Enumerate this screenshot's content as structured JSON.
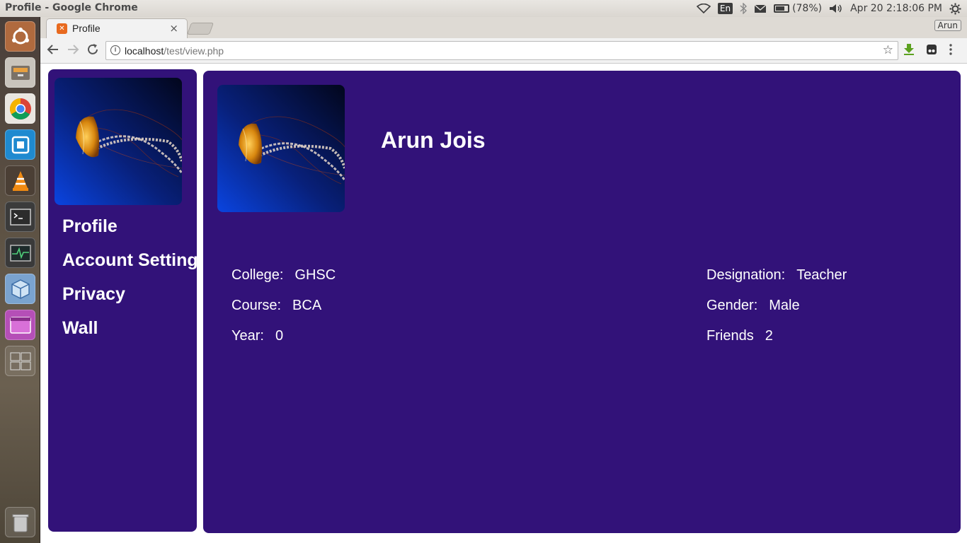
{
  "os": {
    "window_title": "Profile - Google Chrome",
    "tray": {
      "keyboard": "En",
      "battery": "(78%)",
      "battery_level": 0.78,
      "datetime": "Apr 20  2:18:06 PM"
    }
  },
  "browser": {
    "tab_title": "Profile",
    "tab_close": "×",
    "user": "Arun",
    "url_host": "localhost",
    "url_path": "/test/view.php"
  },
  "page": {
    "nav": [
      "Profile",
      "Account Setting",
      "Privacy",
      "Wall"
    ],
    "name": "Arun Jois",
    "left_fields": [
      {
        "label": "College:",
        "value": "GHSC"
      },
      {
        "label": "Course:",
        "value": "BCA"
      },
      {
        "label": "Year:",
        "value": "0"
      }
    ],
    "right_fields": [
      {
        "label": "Designation:",
        "value": "Teacher"
      },
      {
        "label": "Gender:",
        "value": "Male"
      },
      {
        "label": "Friends",
        "value": "2"
      }
    ]
  },
  "colors": {
    "panel_purple": "#321279",
    "avatar_bg_dark": "#050a2a",
    "avatar_bg_blue": "#0a3dd8"
  }
}
